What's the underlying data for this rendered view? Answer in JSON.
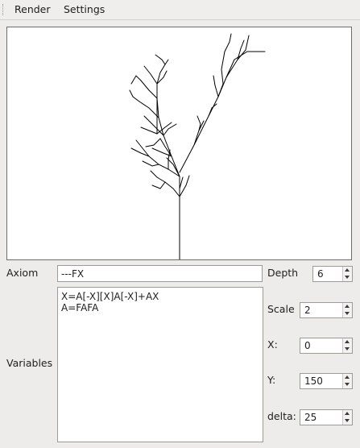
{
  "menu": {
    "items": [
      "Render",
      "Settings"
    ]
  },
  "form": {
    "axiom_label": "Axiom",
    "axiom_value": "---FX",
    "variables_label": "Variables",
    "variables_value": "X=A[-X][X]A[-X]+AX\nA=FAFA"
  },
  "params": {
    "depth": {
      "label": "Depth",
      "value": "6"
    },
    "scale": {
      "label": "Scale",
      "value": "2"
    },
    "x": {
      "label": "X:",
      "value": "0"
    },
    "y": {
      "label": "Y:",
      "value": "150"
    },
    "delta": {
      "label": "delta:",
      "value": "25"
    }
  },
  "colors": {
    "stroke": "#000000",
    "canvas_bg": "#ffffff",
    "window_bg": "#edecea"
  }
}
